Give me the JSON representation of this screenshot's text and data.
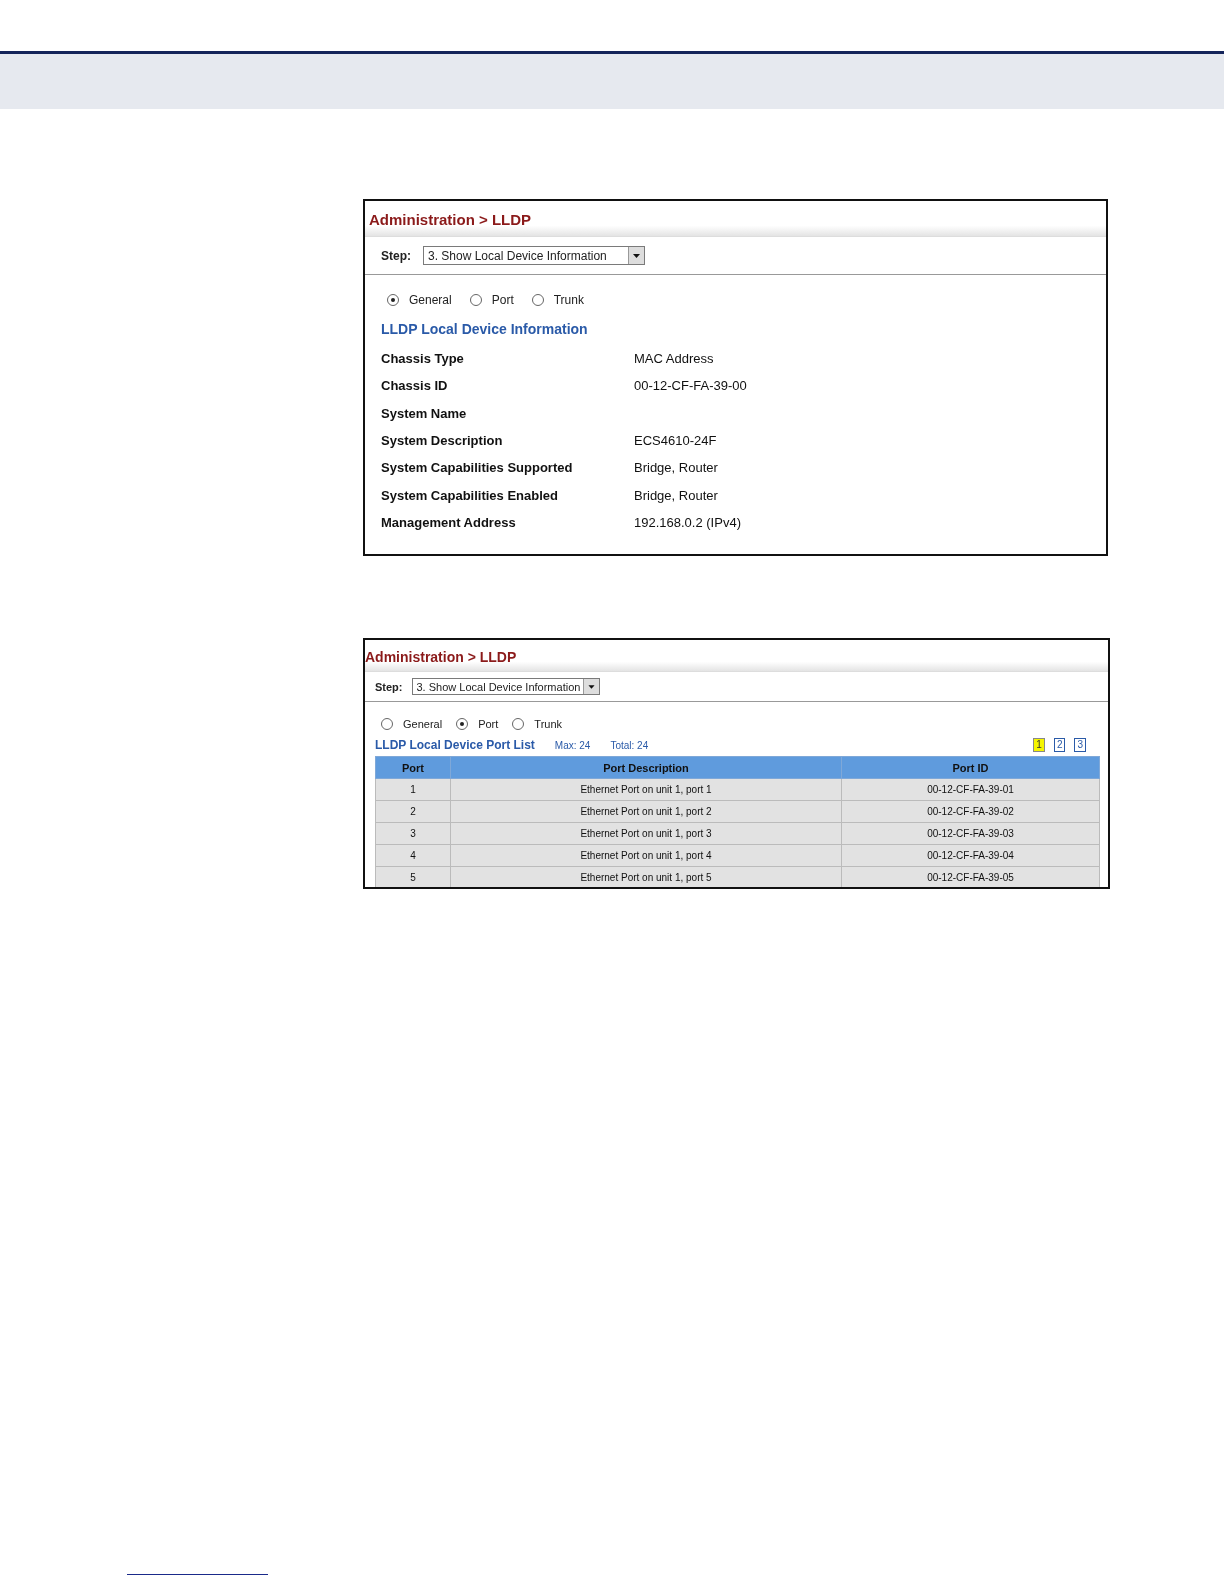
{
  "screenshots": [
    {
      "kind": "general",
      "title": "Administration > LLDP",
      "step_label": "Step:",
      "step_value": "3. Show Local Device Information",
      "radios": [
        {
          "label": "General",
          "selected": true
        },
        {
          "label": "Port",
          "selected": false
        },
        {
          "label": "Trunk",
          "selected": false
        }
      ],
      "section_title": "LLDP Local Device Information",
      "fields": [
        {
          "label": "Chassis Type",
          "value": "MAC Address"
        },
        {
          "label": "Chassis ID",
          "value": "00-12-CF-FA-39-00"
        },
        {
          "label": "System Name"
        },
        {
          "label": "System Description",
          "value": "ECS4610-24F"
        },
        {
          "label": "System Capabilities Supported",
          "value": "Bridge, Router"
        },
        {
          "label": "System Capabilities Enabled",
          "value": "Bridge, Router"
        },
        {
          "label": "Management Address",
          "value": "192.168.0.2 (IPv4)"
        }
      ]
    },
    {
      "kind": "port",
      "title": "Administration > LLDP",
      "step_label": "Step:",
      "step_value": "3. Show Local Device Information",
      "radios": [
        {
          "label": "General",
          "selected": false
        },
        {
          "label": "Port",
          "selected": true
        },
        {
          "label": "Trunk",
          "selected": false
        }
      ],
      "section_title": "LLDP Local Device Port List",
      "max": "Max: 24",
      "total": "Total: 24",
      "pages": [
        {
          "label": "1",
          "selected": true
        },
        {
          "label": "2",
          "selected": false
        },
        {
          "label": "3",
          "selected": false
        }
      ],
      "columns": [
        "Port",
        "Port Description",
        "Port ID"
      ],
      "rows": [
        [
          "1",
          "Ethernet Port on unit 1, port 1",
          "00-12-CF-FA-39-01"
        ],
        [
          "2",
          "Ethernet Port on unit 1, port 2",
          "00-12-CF-FA-39-02"
        ],
        [
          "3",
          "Ethernet Port on unit 1, port 3",
          "00-12-CF-FA-39-03"
        ],
        [
          "4",
          "Ethernet Port on unit 1, port 4",
          "00-12-CF-FA-39-04"
        ],
        [
          "5",
          "Ethernet Port on unit 1, port 5",
          "00-12-CF-FA-39-05"
        ]
      ]
    }
  ]
}
